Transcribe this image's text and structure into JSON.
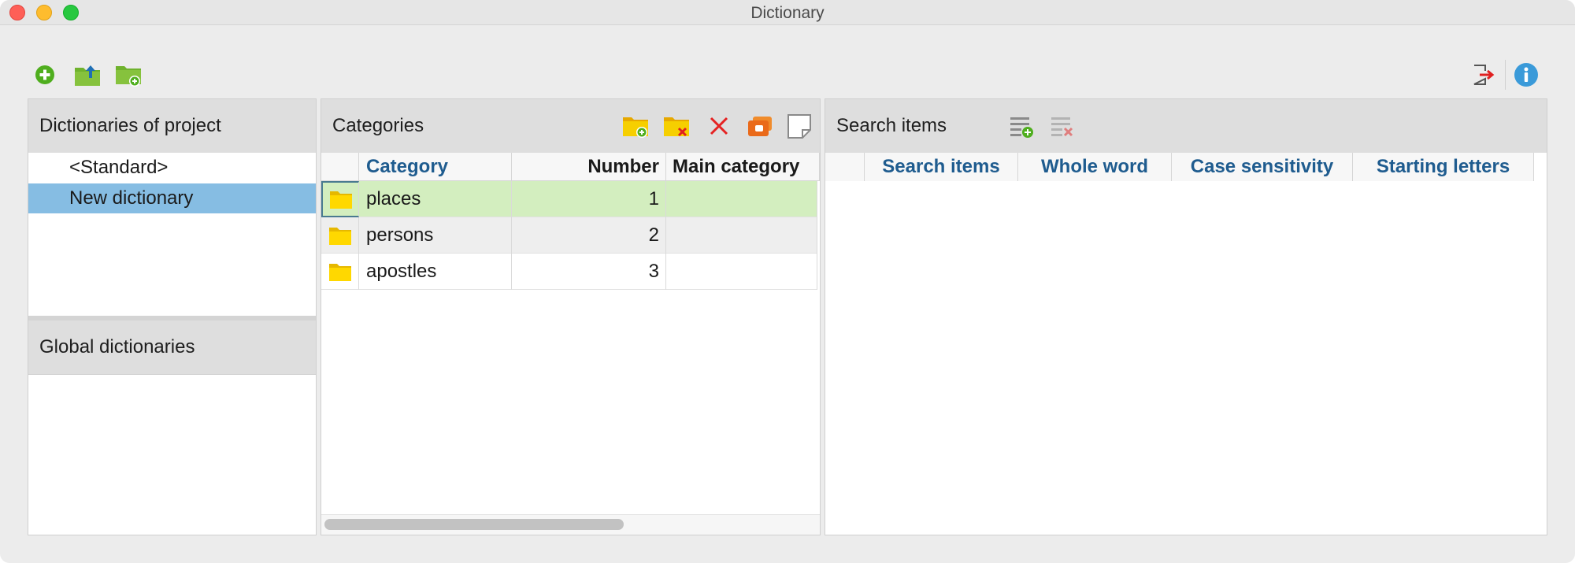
{
  "window": {
    "title": "Dictionary"
  },
  "toolbar": {
    "left_icons": [
      "add-circle-icon",
      "folder-upload-icon",
      "folder-add-icon"
    ],
    "right_icons": [
      "exit-icon",
      "info-icon"
    ]
  },
  "dictionaries": {
    "header": "Dictionaries of project",
    "items": [
      "<Standard>",
      "New dictionary"
    ],
    "selected": "New dictionary"
  },
  "global": {
    "header": "Global dictionaries"
  },
  "categories": {
    "header": "Categories",
    "columns": [
      "Category",
      "Number",
      "Main category"
    ],
    "rows": [
      {
        "category": "places",
        "number": "1",
        "main": ""
      },
      {
        "category": "persons",
        "number": "2",
        "main": ""
      },
      {
        "category": "apostles",
        "number": "3",
        "main": ""
      }
    ],
    "icons": [
      "folder-add-icon",
      "folder-delete-icon",
      "delete-icon",
      "card-icon",
      "memo-icon"
    ],
    "colors": {
      "selected_row": "#d3eebf",
      "folder": "#f6cf00"
    }
  },
  "search_items": {
    "header": "Search items",
    "columns": [
      "Search items",
      "Whole word",
      "Case sensitivity",
      "Starting letters"
    ],
    "icons": [
      "list-add-icon",
      "list-delete-icon"
    ]
  }
}
